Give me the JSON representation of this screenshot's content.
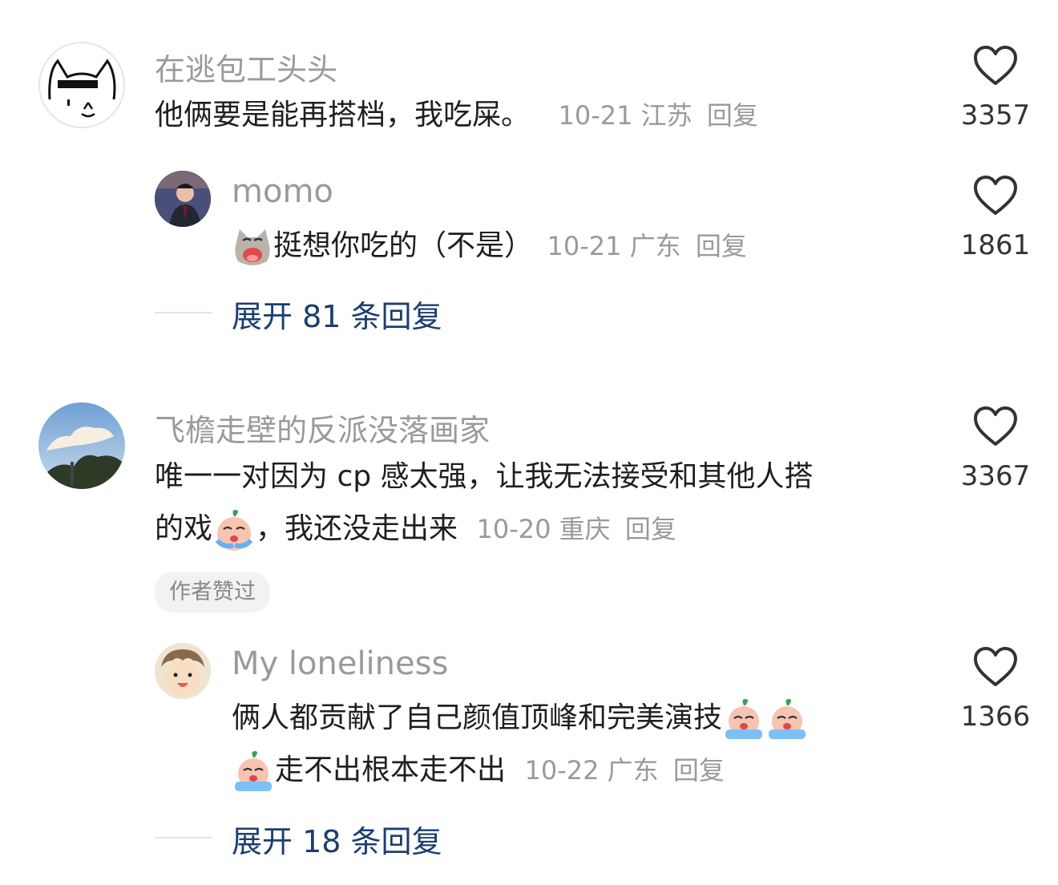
{
  "comments": [
    {
      "username": "在逃包工头头",
      "text": "他俩要是能再搭档，我吃屎。",
      "date": "10-21",
      "location": "江苏",
      "reply_label": "回复",
      "likes": "3357",
      "avatar_icon": "cat-doodle-avatar",
      "replies": [
        {
          "username": "momo",
          "text": "挺想你吃的（不是）",
          "emoji": "crying-cat-emoji",
          "date": "10-21",
          "location": "广东",
          "reply_label": "回复",
          "likes": "1861",
          "avatar_icon": "man-in-suit-avatar"
        }
      ],
      "expand_label": "展开 81 条回复"
    },
    {
      "username": "飞檐走壁的反派没落画家",
      "text_line1": "唯一一对因为 cp 感太强，让我无法接受和其他人搭",
      "text_line2_a": "的戏",
      "text_line2_b": "，我还没走出来",
      "emoji": "crying-peach-emoji",
      "date": "10-20",
      "location": "重庆",
      "reply_label": "回复",
      "likes": "3367",
      "avatar_icon": "sky-clouds-avatar",
      "badge": "作者赞过",
      "replies": [
        {
          "username": "My loneliness",
          "text_line1": "俩人都贡献了自己颜值顶峰和完美演技",
          "text_line2": "走不出根本走不出",
          "emoji": "crying-peach-emoji",
          "date": "10-22",
          "location": "广东",
          "reply_label": "回复",
          "likes": "1366",
          "avatar_icon": "cartoon-face-avatar"
        }
      ],
      "expand_label": "展开 18 条回复"
    }
  ],
  "colors": {
    "meta_gray": "#9a9a9a",
    "expand_blue": "#1c3e70",
    "badge_bg": "#f2f2f2"
  }
}
